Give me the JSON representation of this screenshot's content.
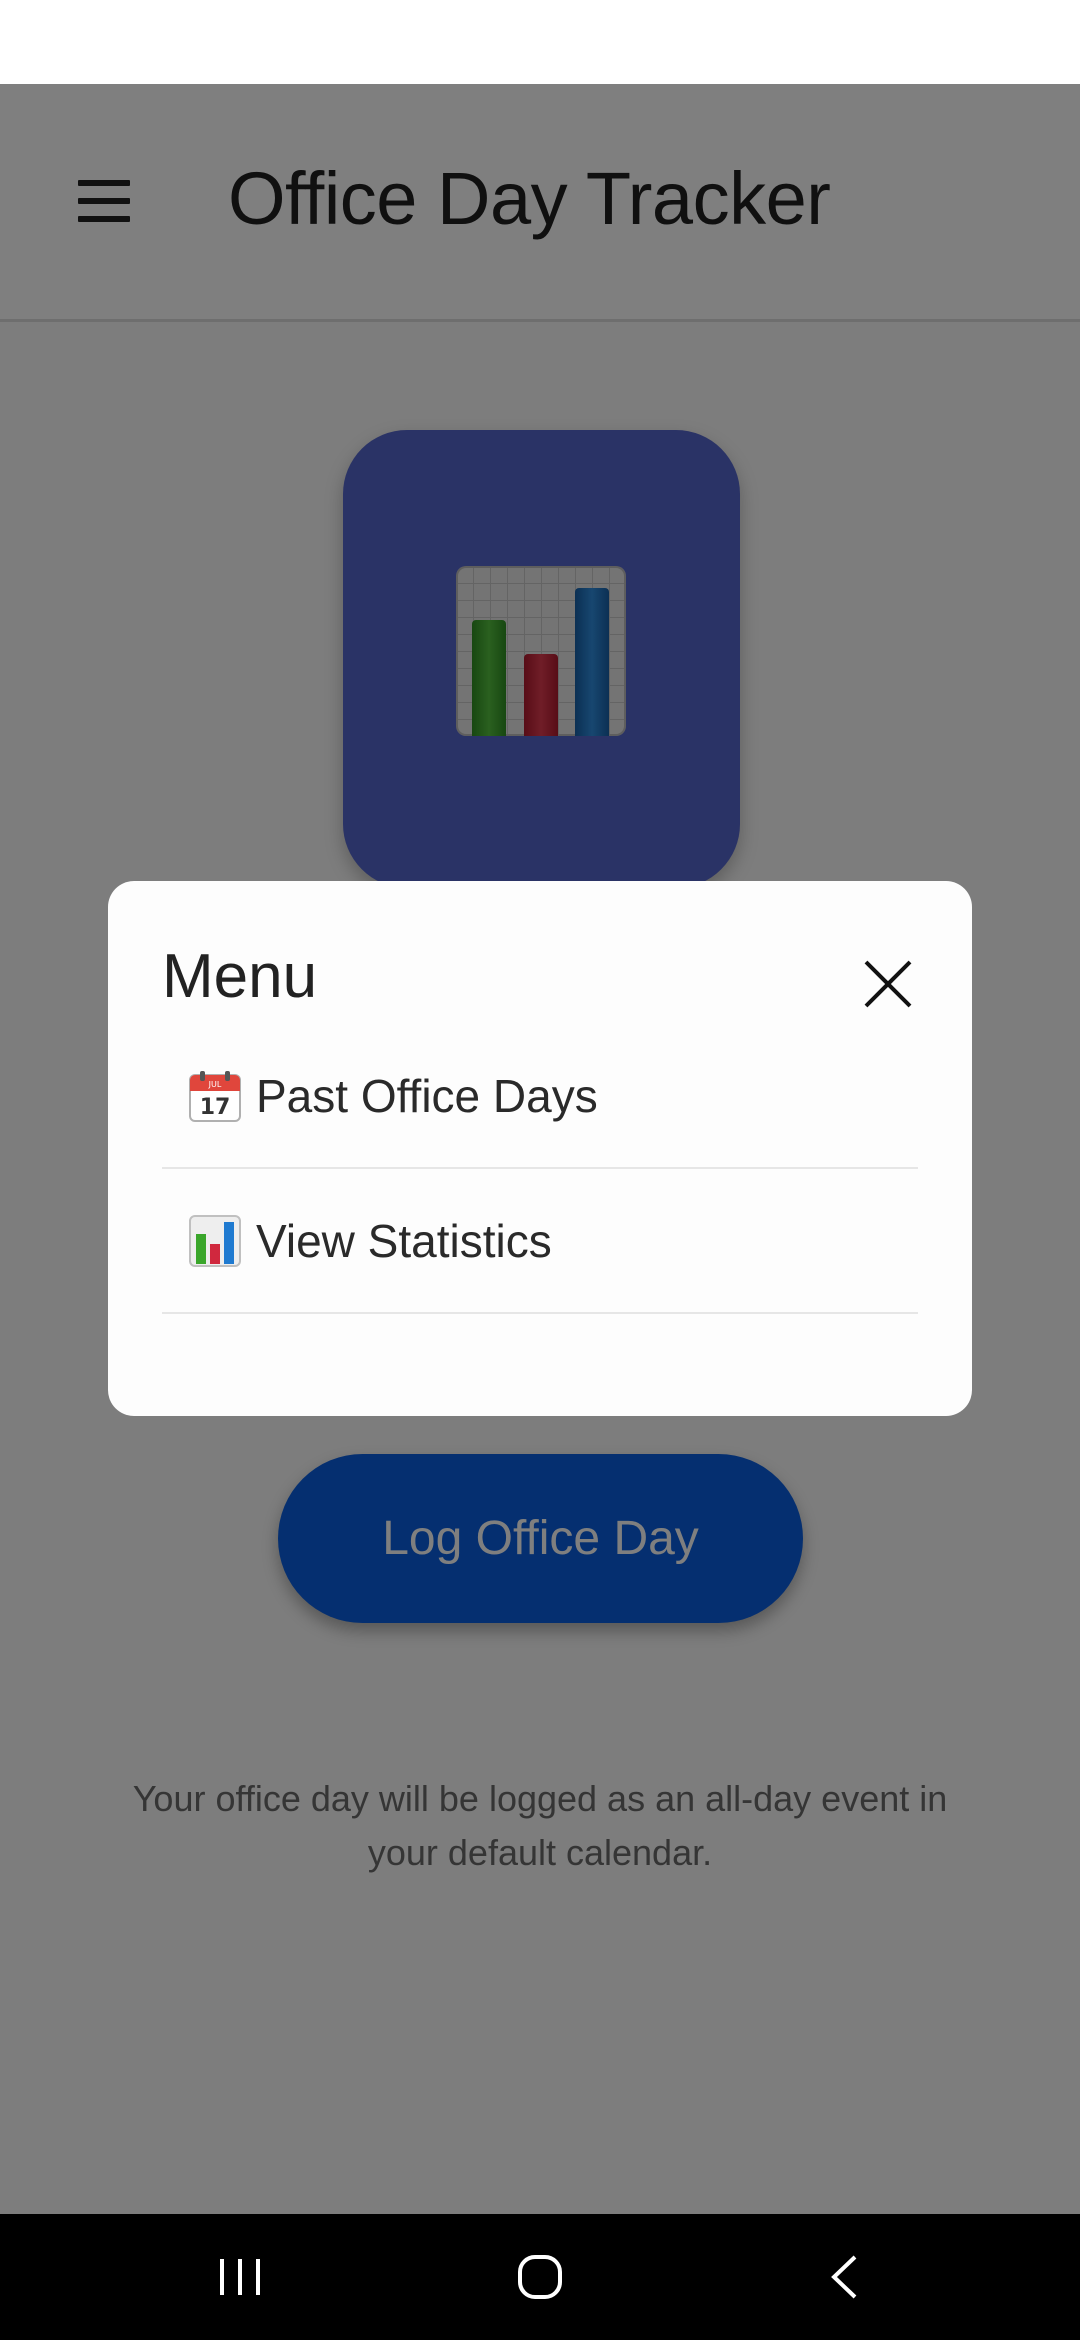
{
  "app": {
    "title": "Office Day Tracker",
    "logo_icon": "bar-chart-icon",
    "primary_button_label": "Log Office Day",
    "footer_note": "Your office day will be logged as an all-day event in your default calendar.",
    "colors": {
      "logo_background": "#5566cc",
      "primary_button": "#0b5fe0",
      "scrim": "rgba(0,0,0,0.5)"
    }
  },
  "menu": {
    "title": "Menu",
    "close_icon": "close-icon",
    "items": [
      {
        "icon": "calendar-icon",
        "icon_text": "JUL 17",
        "label": "Past Office Days"
      },
      {
        "icon": "bar-chart-icon",
        "label": "View Statistics"
      }
    ]
  },
  "nav_bar": {
    "buttons": [
      "recents-icon",
      "home-icon",
      "back-icon"
    ]
  }
}
